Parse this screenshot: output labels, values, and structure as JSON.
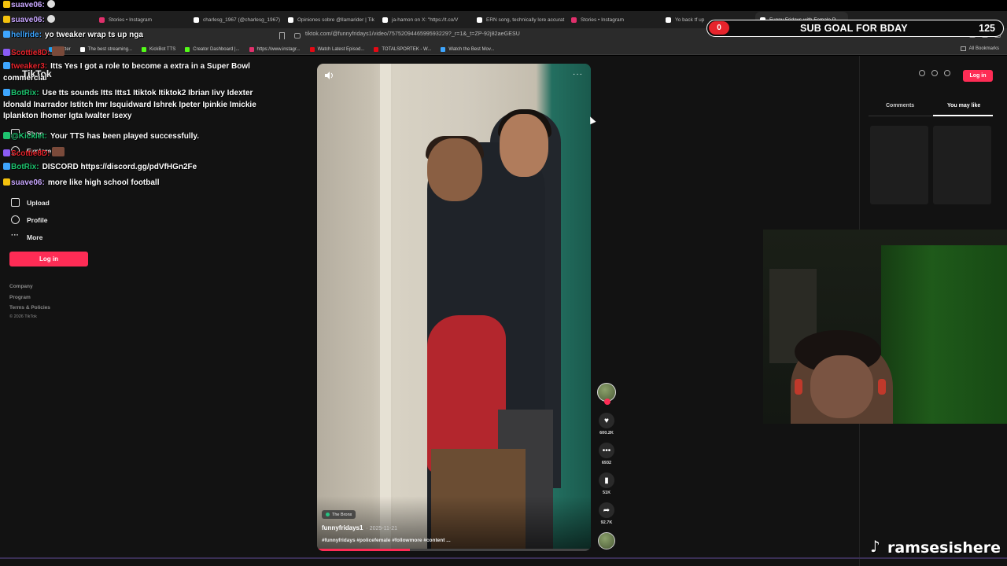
{
  "browser": {
    "tabs": [
      {
        "label": "Stories • Instagram",
        "color": "#e1306c"
      },
      {
        "label": "charlesg_1967 (@charlesg_1967) |",
        "color": "#ffffff"
      },
      {
        "label": "Opiniones sobre @llamarider | Tik",
        "color": "#ffffff"
      },
      {
        "label": "ja-hamon on X: \"https://t.co/V",
        "color": "#ffffff"
      },
      {
        "label": "ERN song, technically lore accurat",
        "color": "#ffffff"
      },
      {
        "label": "Stories • Instagram",
        "color": "#e1306c"
      },
      {
        "label": "Yo back tf up",
        "color": "#ffffff"
      },
      {
        "label": "Funny Fridays with Female P",
        "color": "#ffffff",
        "active": true
      }
    ],
    "url": "tiktok.com/@funnyfridays1/video/7575209446599593229?_r=1&_t=ZP-92j82aeGESU",
    "bookmarks": [
      {
        "label": "Twitter",
        "color": "#1da1f2"
      },
      {
        "label": "The best streaming...",
        "color": "#ffffff"
      },
      {
        "label": "KickBot TTS",
        "color": "#53fc18"
      },
      {
        "label": "Creator Dashboard |...",
        "color": "#53fc18"
      },
      {
        "label": "https://www.instagr...",
        "color": "#e1306c"
      },
      {
        "label": "Watch Latest Episod...",
        "color": "#e50914"
      },
      {
        "label": "TOTALSPORTEK - W...",
        "color": "#e50914"
      },
      {
        "label": "Watch the Best Mov...",
        "color": "#3ea6ff"
      }
    ],
    "all_bookmarks": "All Bookmarks"
  },
  "tiktok": {
    "logo": "TikTok",
    "sidebar": {
      "shop": "Shop",
      "explore": "Explore",
      "upload": "Upload",
      "profile": "Profile",
      "more": "More",
      "login": "Log in",
      "footer": [
        "Company",
        "Program",
        "Terms & Policies"
      ],
      "copyright": "© 2026 TikTok"
    },
    "video": {
      "location": "The Bronx",
      "author": "funnyfridays1",
      "date": "· 2025-11-21",
      "caption": "#funnyfridays #policefemale #followmore #content ...",
      "progress": 0.34
    },
    "actions": {
      "likes": "600.2K",
      "comments": "6932",
      "saves": "51K",
      "shares": "92.7K"
    },
    "right_panel": {
      "login": "Log in",
      "tab_comments": "Comments",
      "tab_you_may_like": "You may like"
    }
  },
  "stream": {
    "chat": [
      {
        "user": "suave06:",
        "text": "",
        "user_color": "#c9a7ff"
      },
      {
        "user": "suave06:",
        "text": "",
        "user_color": "#c9a7ff"
      },
      {
        "user": "hellride:",
        "text": "yo tweaker wrap ts up nga",
        "user_color": "#3ea6ff"
      },
      {
        "user": "Scottie8D:",
        "text": "",
        "user_color": "#e6242c"
      },
      {
        "user": "tweaker3:",
        "text": "Itts Yes I got a role to become a extra in a Super Bowl commercial",
        "user_color": "#e6242c"
      },
      {
        "user": "BotRix:",
        "text": "Use tts sounds Itts Itts1 Itiktok Itiktok2 Ibrian Iivy Idexter Idonald Inarrador Istitch Imr Isquidward Ishrek Ipeter Ipinkie Imickie Iplankton Ihomer Igta Iwalter Isexy",
        "user_color": "#1ec46f"
      },
      {
        "user": "@Kicklet:",
        "text": "Your TTS has been played successfully.",
        "user_color": "#1ec46f"
      },
      {
        "user": "Scottie8D:",
        "text": "",
        "user_color": "#e6242c"
      },
      {
        "user": "BotRix:",
        "text": "DISCORD https://discord.gg/pdVfHGn2Fe",
        "user_color": "#1ec46f"
      },
      {
        "user": "suave06:",
        "text": "more like high school football",
        "user_color": "#c9a7ff"
      }
    ],
    "sub_goal": {
      "current": "0",
      "label": "SUB GOAL FOR BDAY",
      "target": "125",
      "accent": "#e6242c"
    },
    "watermark": "ramsesishere"
  }
}
